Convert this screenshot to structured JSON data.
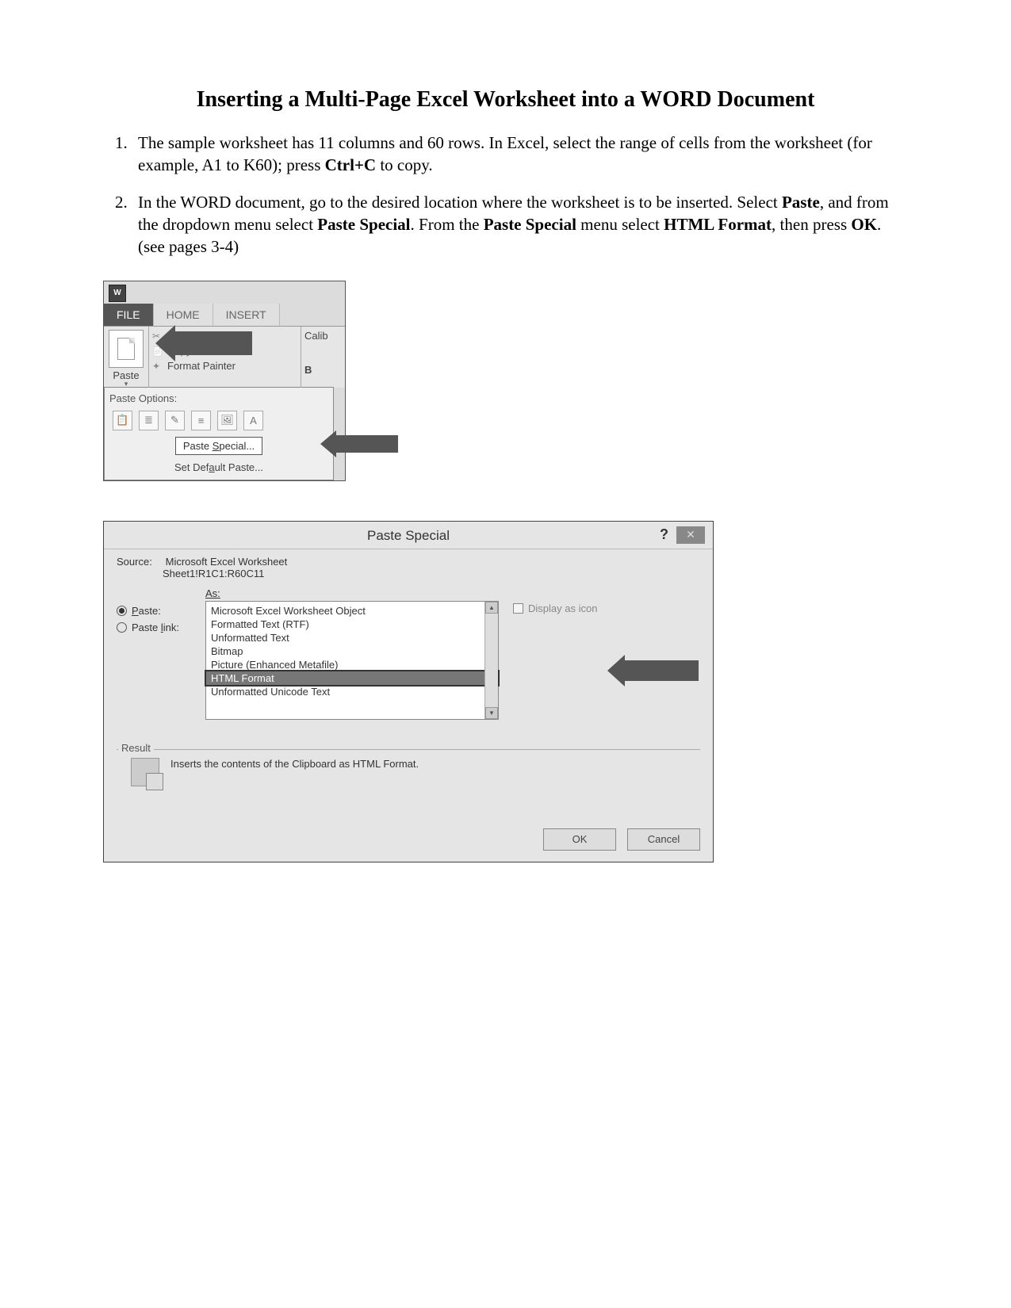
{
  "title": "Inserting a Multi-Page Excel Worksheet into a WORD Document",
  "steps": {
    "s1_a": "The sample worksheet has 11 columns and 60 rows. In Excel, select the range of cells from the worksheet (for example, A1 to K60); press ",
    "s1_b": "Ctrl+C",
    "s1_c": " to copy.",
    "s2_a": "In the WORD document, go to the desired location where the worksheet is to be inserted. Select ",
    "s2_b": "Paste",
    "s2_c": ", and from the dropdown menu select ",
    "s2_d": "Paste Special",
    "s2_e": ". From the ",
    "s2_f": "Paste Special",
    "s2_g": " menu select ",
    "s2_h": "HTML Format",
    "s2_i": ", then press ",
    "s2_j": "OK",
    "s2_k": ". (see pages 3-4)"
  },
  "ribbon": {
    "app": "W",
    "tabs": {
      "file": "FILE",
      "home": "HOME",
      "insert": "INSERT"
    },
    "paste": "Paste",
    "cut": "Cut",
    "copy": "Copy",
    "format_painter": "Format Painter",
    "font": "Calib",
    "b": "B",
    "dropdown": {
      "header": "Paste Options:",
      "paste_special": "Paste Special...",
      "set_default": "Set Default Paste..."
    }
  },
  "dialog": {
    "title": "Paste Special",
    "help": "?",
    "close": "✕",
    "source_lbl": "Source:",
    "source_val": "Microsoft Excel Worksheet",
    "source_range": "Sheet1!R1C1:R60C11",
    "as": "As:",
    "radio_paste": "Paste:",
    "radio_link": "Paste link:",
    "list": {
      "i0": "Microsoft Excel Worksheet Object",
      "i1": "Formatted Text (RTF)",
      "i2": "Unformatted Text",
      "i3": "Bitmap",
      "i4": "Picture (Enhanced Metafile)",
      "i5": "HTML Format",
      "i6": "Unformatted Unicode Text"
    },
    "display_as_icon": "Display as icon",
    "result_lbl": "Result",
    "result_txt": "Inserts the contents of the Clipboard as HTML Format.",
    "ok": "OK",
    "cancel": "Cancel"
  }
}
